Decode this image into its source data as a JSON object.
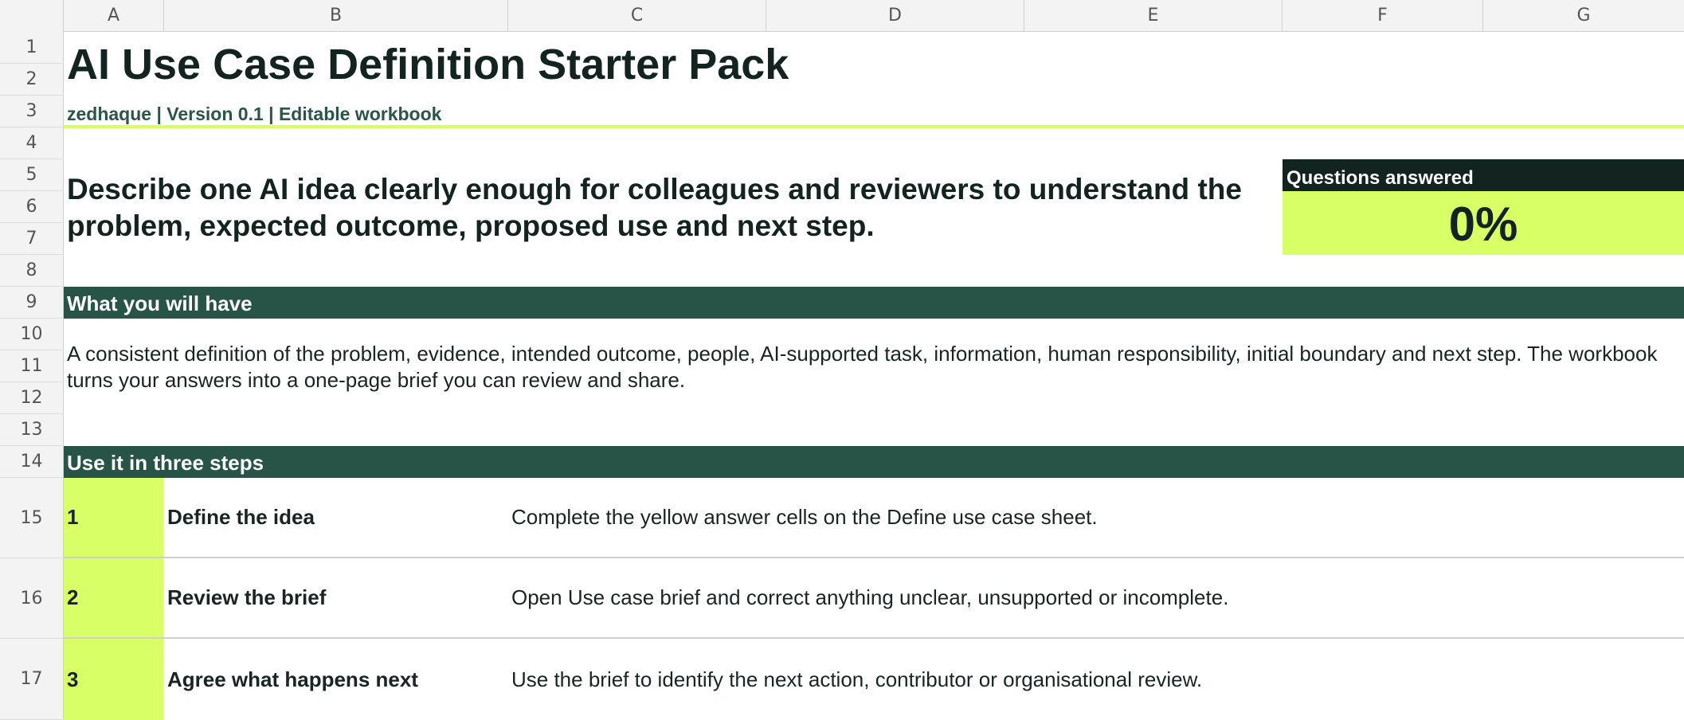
{
  "columns": [
    "A",
    "B",
    "C",
    "D",
    "E",
    "F",
    "G"
  ],
  "rows": [
    "1",
    "2",
    "3",
    "4",
    "5",
    "6",
    "7",
    "8",
    "9",
    "10",
    "11",
    "12",
    "13",
    "14",
    "15",
    "16",
    "17"
  ],
  "header": {
    "title": "AI Use Case Definition Starter Pack",
    "subtitle": "zedhaque  |  Version 0.1  |  Editable workbook"
  },
  "lead": "Describe one AI idea clearly enough for colleagues and reviewers to understand the problem, expected outcome, proposed use and next step.",
  "progress": {
    "label": "Questions answered",
    "value": "0%"
  },
  "have_section": {
    "heading": "What you will have",
    "body": "A consistent definition of the problem, evidence, intended outcome, people, AI-supported task, information, human responsibility, initial boundary and next step. The workbook turns your answers into a one-page brief you can review and share."
  },
  "steps_section": {
    "heading": "Use it in three steps",
    "steps": [
      {
        "num": "1",
        "title": "Define the idea",
        "desc": "Complete the yellow answer cells on the Define use case sheet."
      },
      {
        "num": "2",
        "title": "Review the brief",
        "desc": "Open Use case brief and correct anything unclear, unsupported or incomplete."
      },
      {
        "num": "3",
        "title": "Agree what happens next",
        "desc": "Use the brief to identify the next action, contributor or organisational review."
      }
    ]
  },
  "colors": {
    "accent": "#d9ff66",
    "band": "#285447",
    "dark": "#13231f"
  }
}
